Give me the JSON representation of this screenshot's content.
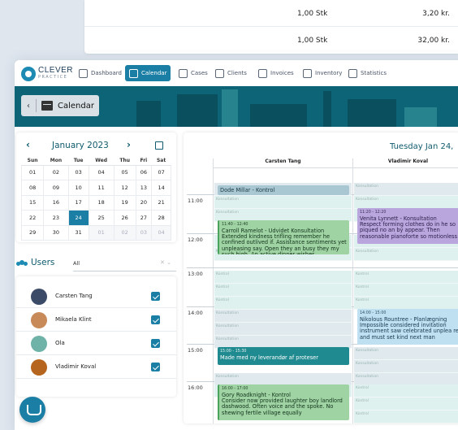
{
  "top_card": {
    "rows": [
      {
        "qty": "1,00 Stk",
        "amount": "3,20 kr."
      },
      {
        "qty": "1,00 Stk",
        "amount": "32,00 kr."
      }
    ]
  },
  "brand": {
    "name": "CLEVER",
    "sub": "PRACTICE"
  },
  "nav": [
    {
      "label": "Dashboard",
      "icon": "home-icon"
    },
    {
      "label": "Calendar",
      "icon": "calendar-icon",
      "active": true
    },
    {
      "label": "Cases",
      "icon": "document-icon"
    },
    {
      "label": "Clients",
      "icon": "clients-icon"
    },
    {
      "label": "Invoices",
      "icon": "invoice-icon"
    },
    {
      "label": "Inventory",
      "icon": "inventory-icon"
    },
    {
      "label": "Statistics",
      "icon": "chart-icon"
    }
  ],
  "page": {
    "title": "Calendar"
  },
  "mini_calendar": {
    "month_label": "January 2023",
    "weekdays": [
      "Sun",
      "Mon",
      "Tue",
      "Wed",
      "Thu",
      "Fri",
      "Sat"
    ],
    "weeks": [
      [
        "01",
        "02",
        "03",
        "04",
        "05",
        "06",
        "07"
      ],
      [
        "08",
        "09",
        "10",
        "11",
        "12",
        "13",
        "14"
      ],
      [
        "15",
        "16",
        "17",
        "18",
        "19",
        "20",
        "21"
      ],
      [
        "22",
        "23",
        "24",
        "25",
        "26",
        "27",
        "28"
      ],
      [
        "29",
        "30",
        "31",
        "01",
        "02",
        "03",
        "04"
      ]
    ],
    "selected": "24"
  },
  "users": {
    "heading": "Users",
    "filter_value": "All",
    "list": [
      {
        "name": "Carsten Tang",
        "checked": true,
        "avatar_color": "#3b4a66"
      },
      {
        "name": "Mikaela Klint",
        "checked": true,
        "avatar_color": "#c98a5a"
      },
      {
        "name": "Ola",
        "checked": true,
        "avatar_color": "#6fb3a8"
      },
      {
        "name": "Vladimir Koval",
        "checked": true,
        "avatar_color": "#b5651d"
      }
    ]
  },
  "schedule": {
    "date_title": "Tuesday Jan 24,",
    "columns": [
      "Carsten Tang",
      "Vladimir Koval"
    ],
    "hours": [
      "11:00",
      "12:00",
      "13:00",
      "14:00",
      "15:00",
      "16:00"
    ],
    "slot_labels": {
      "konsultation": "Konsultation",
      "kontrol": "Kontrol",
      "planlaegning": "Planlægning"
    },
    "events": [
      {
        "col": 0,
        "title": "Dode Millar - Kontrol",
        "time": "",
        "body": "",
        "color": "slate"
      },
      {
        "col": 0,
        "time": "11:40 - 12:40",
        "title": "Carroll Ramelot - Udvidet Konsultation",
        "body": "Extended kindness trifling remember he confined outlived if. Assistance sentiments yet unpleasing say. Open they an busy they my such high. An active dinner wishes",
        "color": "green"
      },
      {
        "col": 1,
        "time": "11:20 - 12:20",
        "title": "Venita Lynnett - Konsultation",
        "body": "Respect forming clothes do in he so piqued no an by appear. Then reasonable pianoforte so motionless",
        "color": "lav"
      },
      {
        "col": 1,
        "time": "14:00 - 15:00",
        "title": "Nikolous Rountree - Planlægning",
        "body": "Impossible considered invitation instrument saw celebrated unplea rest and must set kind next man",
        "color": "blue"
      },
      {
        "col": 0,
        "time": "15:00 - 15:30",
        "title": "Made med ny leverandør af proteser",
        "body": "",
        "color": "teal"
      },
      {
        "col": 0,
        "time": "16:00 - 17:00",
        "title": "Gory Roadknight - Kontrol",
        "body": "Consider now provided laughter boy landlord dashwood. Often voice and the spoke. No shewing fertile village equally",
        "color": "green"
      }
    ]
  },
  "colors": {
    "accent": "#1b7fa5",
    "hero": "#0e6477",
    "title": "#0e5a6d"
  }
}
